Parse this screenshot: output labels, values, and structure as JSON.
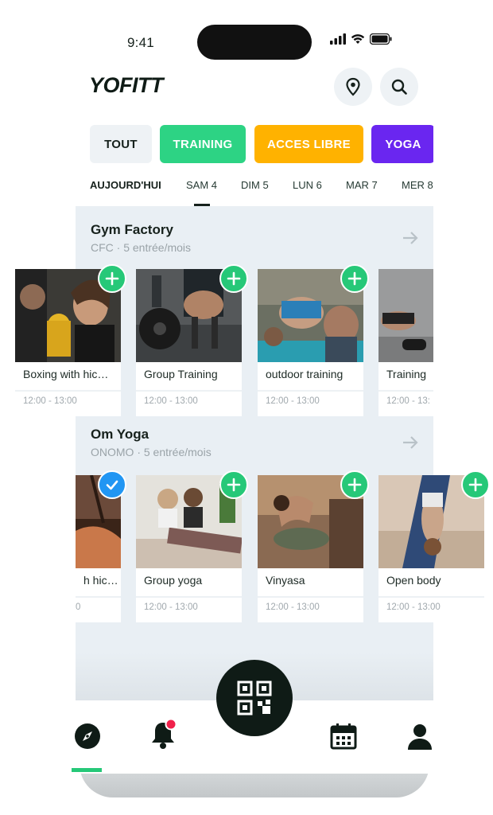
{
  "status_bar": {
    "time": "9:41"
  },
  "header": {
    "logo": "YOFITT",
    "location_icon": "location-pin-icon",
    "search_icon": "search-icon"
  },
  "filters": [
    {
      "label": "TOUT",
      "color": "#eef2f5",
      "text_color": "#16211c"
    },
    {
      "label": "TRAINING",
      "color": "#2dd384",
      "text_color": "#ffffff"
    },
    {
      "label": "ACCES LIBRE",
      "color": "#ffb200",
      "text_color": "#ffffff"
    },
    {
      "label": "YOGA",
      "color": "#6a26f0",
      "text_color": "#ffffff"
    }
  ],
  "days": [
    {
      "label": "AUJOURD'HUI",
      "active": false,
      "bold": true
    },
    {
      "label": "SAM 4",
      "active": true
    },
    {
      "label": "DIM 5"
    },
    {
      "label": "LUN 6"
    },
    {
      "label": "MAR 7"
    },
    {
      "label": "MER 8"
    }
  ],
  "gyms": [
    {
      "name": "Gym Factory",
      "subtitle": "CFC · 5 entrée/mois",
      "classes": [
        {
          "title": "Boxing with hic…",
          "time": "12:00 - 13:00",
          "state": "add"
        },
        {
          "title": "Group Training",
          "time": "12:00 - 13:00",
          "state": "add"
        },
        {
          "title": "outdoor training",
          "time": "12:00 - 13:00",
          "state": "add"
        },
        {
          "title": "Training",
          "time": "12:00 - 13:",
          "state": "none"
        }
      ]
    },
    {
      "name": "Om Yoga",
      "subtitle": "ONOMO · 5 entrée/mois",
      "classes": [
        {
          "title": "h hic…",
          "time": "0",
          "state": "checked"
        },
        {
          "title": "Group yoga",
          "time": "12:00 - 13:00",
          "state": "add"
        },
        {
          "title": "Vinyasa",
          "time": "12:00 - 13:00",
          "state": "add"
        },
        {
          "title": "Open body",
          "time": "12:00 - 13:00",
          "state": "add"
        }
      ]
    }
  ],
  "bottom_nav": {
    "items": [
      "explore-icon",
      "notifications-icon",
      "qr-code-icon",
      "calendar-icon",
      "profile-icon"
    ],
    "accent": "#26c878",
    "badge_color": "#f0204a"
  }
}
